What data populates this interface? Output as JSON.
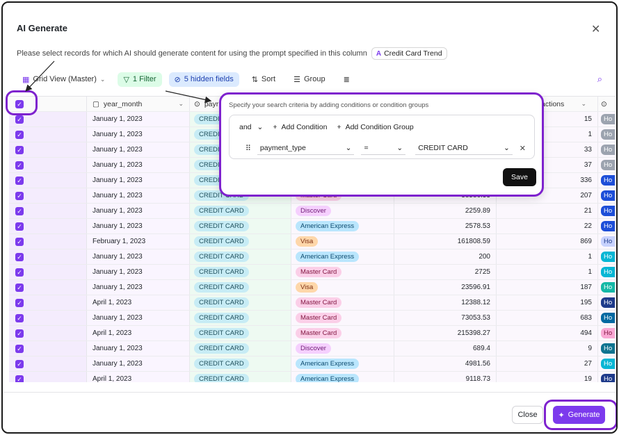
{
  "dialog": {
    "title": "AI Generate",
    "description": "Please select records for which AI should generate content for using the prompt specified in this column",
    "column_chip": {
      "icon": "A",
      "label": "Credit Card Trend"
    }
  },
  "toolbar": {
    "view": "Grid View (Master)",
    "filter": "1 Filter",
    "hidden_fields": "5 hidden fields",
    "sort": "Sort",
    "group": "Group"
  },
  "table": {
    "headers": {
      "date": "year_month",
      "payment": "payr",
      "transactions": "actions"
    },
    "rows": [
      {
        "date": "January 1, 2023",
        "pay": "CREDIT CARD",
        "card": "",
        "amount": "",
        "trx": "15",
        "ho": "Ho",
        "ho_color": "#9ca3af"
      },
      {
        "date": "January 1, 2023",
        "pay": "CREDIT CARD",
        "card": "",
        "amount": "",
        "trx": "1",
        "ho": "Ho",
        "ho_color": "#9ca3af"
      },
      {
        "date": "January 1, 2023",
        "pay": "CREDIT CARD",
        "card": "",
        "amount": "",
        "trx": "33",
        "ho": "Ho",
        "ho_color": "#9ca3af"
      },
      {
        "date": "January 1, 2023",
        "pay": "CREDIT CARD",
        "card": "",
        "amount": "",
        "trx": "37",
        "ho": "Ho",
        "ho_color": "#9ca3af"
      },
      {
        "date": "January 1, 2023",
        "pay": "CREDIT CARD",
        "card": "",
        "amount": "",
        "trx": "336",
        "ho": "Ho",
        "ho_color": "#1d4ed8"
      },
      {
        "date": "January 1, 2023",
        "pay": "CREDIT CARD",
        "card": "Master Card",
        "card_bg": "#fbcfe8",
        "card_fg": "#831843",
        "amount": "38586.53",
        "trx": "207",
        "ho": "Ho",
        "ho_color": "#1d4ed8"
      },
      {
        "date": "January 1, 2023",
        "pay": "CREDIT CARD",
        "card": "Discover",
        "card_bg": "#f5d0fe",
        "card_fg": "#701a75",
        "amount": "2259.89",
        "trx": "21",
        "ho": "Ho",
        "ho_color": "#1d4ed8"
      },
      {
        "date": "January 1, 2023",
        "pay": "CREDIT CARD",
        "card": "American Express",
        "card_bg": "#bae6fd",
        "card_fg": "#0c4a6e",
        "amount": "2578.53",
        "trx": "22",
        "ho": "Ho",
        "ho_color": "#1d4ed8"
      },
      {
        "date": "February 1, 2023",
        "pay": "CREDIT CARD",
        "card": "Visa",
        "card_bg": "#fed7aa",
        "card_fg": "#7c2d12",
        "amount": "161808.59",
        "trx": "869",
        "ho": "Ho",
        "ho_color": "#c7d2fe",
        "ho_text": "#1e3a8a"
      },
      {
        "date": "January 1, 2023",
        "pay": "CREDIT CARD",
        "card": "American Express",
        "card_bg": "#bae6fd",
        "card_fg": "#0c4a6e",
        "amount": "200",
        "trx": "1",
        "ho": "Ho",
        "ho_color": "#06b6d4"
      },
      {
        "date": "January 1, 2023",
        "pay": "CREDIT CARD",
        "card": "Master Card",
        "card_bg": "#fbcfe8",
        "card_fg": "#831843",
        "amount": "2725",
        "trx": "1",
        "ho": "Ho",
        "ho_color": "#06b6d4"
      },
      {
        "date": "January 1, 2023",
        "pay": "CREDIT CARD",
        "card": "Visa",
        "card_bg": "#fed7aa",
        "card_fg": "#7c2d12",
        "amount": "23596.91",
        "trx": "187",
        "ho": "Ho",
        "ho_color": "#14b8a6"
      },
      {
        "date": "April 1, 2023",
        "pay": "CREDIT CARD",
        "card": "Master Card",
        "card_bg": "#fbcfe8",
        "card_fg": "#831843",
        "amount": "12388.12",
        "trx": "195",
        "ho": "Ho",
        "ho_color": "#1e3a8a"
      },
      {
        "date": "January 1, 2023",
        "pay": "CREDIT CARD",
        "card": "Master Card",
        "card_bg": "#fbcfe8",
        "card_fg": "#831843",
        "amount": "73053.53",
        "trx": "683",
        "ho": "Ho",
        "ho_color": "#0369a1"
      },
      {
        "date": "April 1, 2023",
        "pay": "CREDIT CARD",
        "card": "Master Card",
        "card_bg": "#fbcfe8",
        "card_fg": "#831843",
        "amount": "215398.27",
        "trx": "494",
        "ho": "Ho",
        "ho_color": "#f9a8d4",
        "ho_text": "#831843"
      },
      {
        "date": "January 1, 2023",
        "pay": "CREDIT CARD",
        "card": "Discover",
        "card_bg": "#f5d0fe",
        "card_fg": "#701a75",
        "amount": "689.4",
        "trx": "9",
        "ho": "Ho",
        "ho_color": "#0e7490"
      },
      {
        "date": "January 1, 2023",
        "pay": "CREDIT CARD",
        "card": "American Express",
        "card_bg": "#bae6fd",
        "card_fg": "#0c4a6e",
        "amount": "4981.56",
        "trx": "27",
        "ho": "Ho",
        "ho_color": "#06b6d4"
      },
      {
        "date": "April 1, 2023",
        "pay": "CREDIT CARD",
        "card": "American Express",
        "card_bg": "#bae6fd",
        "card_fg": "#0c4a6e",
        "amount": "9118.73",
        "trx": "19",
        "ho": "Ho",
        "ho_color": "#1e3a8a"
      }
    ]
  },
  "filter_popup": {
    "hint": "Specify your search criteria by adding conditions or condition groups",
    "logic": "and",
    "add_condition": "Add Condition",
    "add_group": "Add Condition Group",
    "field": "payment_type",
    "operator": "=",
    "value": "CREDIT CARD",
    "save": "Save"
  },
  "footer": {
    "close": "Close",
    "generate": "Generate"
  },
  "colors": {
    "accent": "#7c3aed",
    "highlight": "#7e22ce"
  }
}
